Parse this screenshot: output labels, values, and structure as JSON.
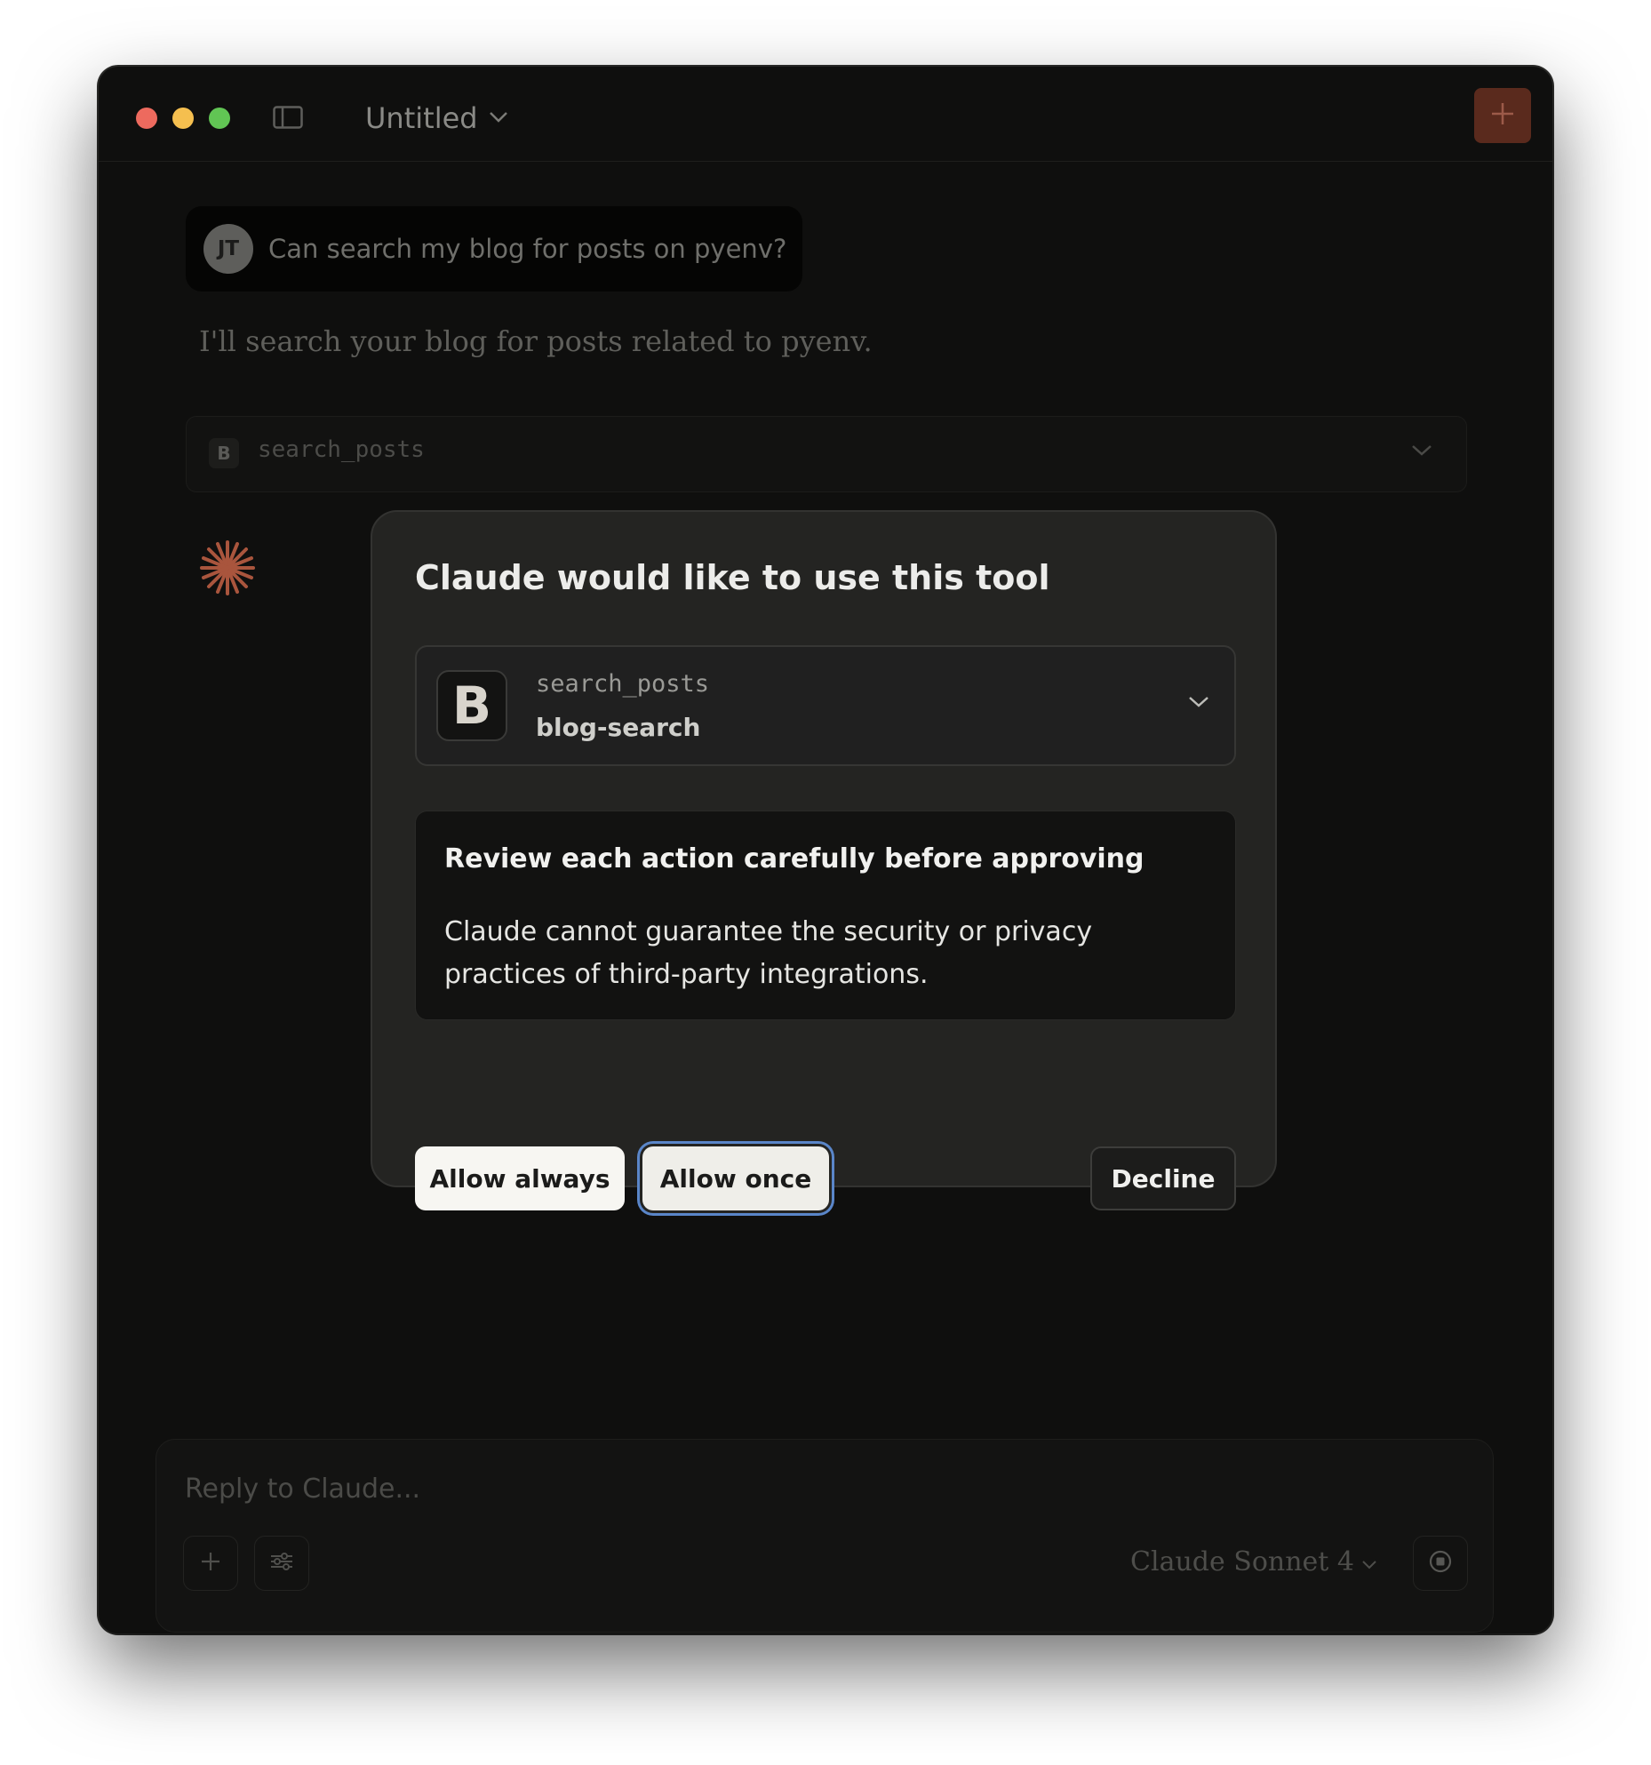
{
  "window": {
    "title": "Untitled"
  },
  "conversation": {
    "user": {
      "initials": "JT",
      "message": "Can search my blog for posts on pyenv?"
    },
    "assistant": {
      "message": "I'll search your blog for posts related to pyenv."
    },
    "tool_call": {
      "badge": "B",
      "name": "search_posts"
    }
  },
  "modal": {
    "title": "Claude would like to use this tool",
    "tool": {
      "icon_letter": "B",
      "name": "search_posts",
      "server": "blog-search"
    },
    "warning": {
      "title": "Review each action carefully before approving",
      "body": "Claude cannot guarantee the security or privacy practices of third-party integrations."
    },
    "buttons": {
      "allow_always": "Allow always",
      "allow_once": "Allow once",
      "decline": "Decline"
    }
  },
  "composer": {
    "placeholder": "Reply to Claude...",
    "model": "Claude Sonnet 4"
  },
  "colors": {
    "accent": "#5a2a1d",
    "spinner": "#a9553d",
    "focus_ring": "#5a86c9"
  }
}
